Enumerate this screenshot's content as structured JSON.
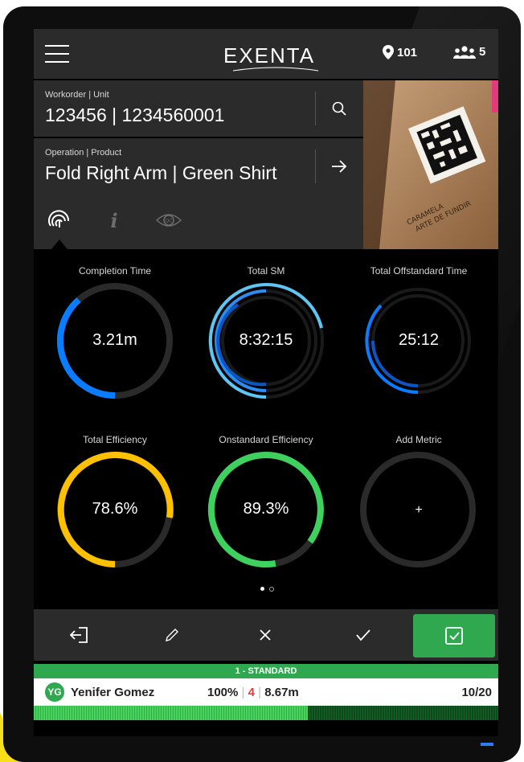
{
  "header": {
    "logo": "EXENTA",
    "location_count": "101",
    "users_count": "5"
  },
  "workorder": {
    "label": "Workorder | Unit",
    "value": "123456 | 1234560001"
  },
  "operation": {
    "label": "Operation | Product",
    "value": "Fold Right Arm | Green Shirt"
  },
  "photo": {
    "box_text_1": "CARAMELA",
    "box_text_2": "ARTE DE FUNDIR"
  },
  "tabs": [
    {
      "name": "performance",
      "icon": "fingerprint-icon",
      "active": true
    },
    {
      "name": "info",
      "icon": "info-icon",
      "active": false
    },
    {
      "name": "qc",
      "icon": "qc-eye-icon",
      "active": false,
      "label": "QC"
    }
  ],
  "metrics": [
    {
      "title": "Completion Time",
      "value": "3.21m",
      "color": "#0a7cff"
    },
    {
      "title": "Total SM",
      "value": "8:32:15",
      "color": "#5ec6f5"
    },
    {
      "title": "Total Offstandard Time",
      "value": "25:12",
      "color": "#0a6ee0"
    },
    {
      "title": "Total Efficiency",
      "value": "78.6%",
      "color": "#ffc000",
      "fraction": 0.786
    },
    {
      "title": "Onstandard Efficiency",
      "value": "89.3%",
      "color": "#3ed15e",
      "fraction": 0.893
    },
    {
      "title": "Add Metric",
      "value": "+",
      "color": "#2a2a2a"
    }
  ],
  "pager": {
    "pages": 2,
    "current": 1
  },
  "actions": [
    "exit-icon",
    "pencil-icon",
    "close-icon",
    "check-icon",
    "checkbox-confirm-icon"
  ],
  "operator_panel": {
    "standard_label": "1 - STANDARD",
    "initials": "YG",
    "name": "Yenifer Gomez",
    "efficiency": "100%",
    "separator": "|",
    "defects": "4",
    "time": "8.67m",
    "count": "10/20",
    "progress_fraction": 0.59
  },
  "colors": {
    "accent_green": "#2fa84f",
    "defect_red": "#e53935",
    "blue": "#0a7cff",
    "yellow": "#ffc000"
  }
}
